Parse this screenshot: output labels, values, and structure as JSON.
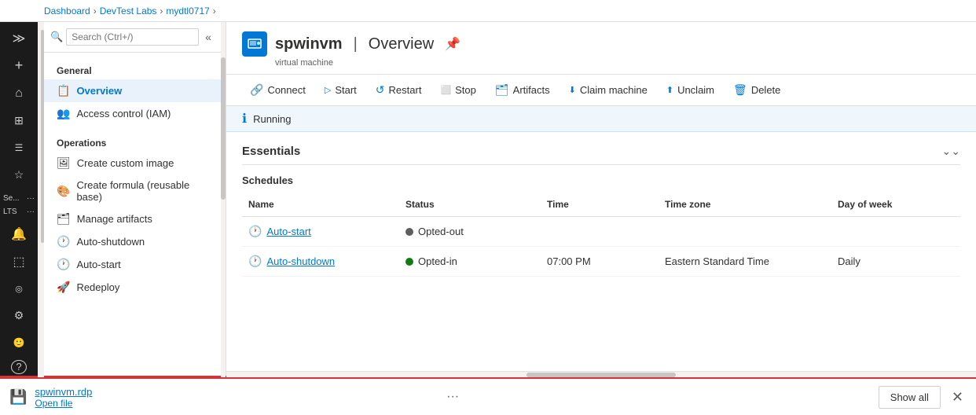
{
  "breadcrumb": {
    "items": [
      "Dashboard",
      "DevTest Labs",
      "mydtl0717"
    ],
    "separators": [
      ">",
      ">"
    ]
  },
  "sidebar_icons": [
    {
      "name": "expand-icon",
      "glyph": "≫"
    },
    {
      "name": "plus-icon",
      "glyph": "+"
    },
    {
      "name": "home-icon",
      "glyph": "⌂"
    },
    {
      "name": "grid-icon",
      "glyph": "⊞"
    },
    {
      "name": "menu-icon",
      "glyph": "☰"
    },
    {
      "name": "star-icon",
      "glyph": "☆"
    },
    {
      "name": "notification-icon",
      "glyph": "🔔"
    },
    {
      "name": "cloud-icon",
      "glyph": "☁"
    },
    {
      "name": "person-icon",
      "glyph": "👤"
    },
    {
      "name": "key-icon",
      "glyph": "🔑"
    },
    {
      "name": "settings-icon",
      "glyph": "⚙"
    },
    {
      "name": "chart-icon",
      "glyph": "📊"
    },
    {
      "name": "help-icon",
      "glyph": "?"
    }
  ],
  "side_tabs": [
    {
      "label": "Se...",
      "more": "···"
    },
    {
      "label": "LTS",
      "more": "···"
    }
  ],
  "nav": {
    "search_placeholder": "Search (Ctrl+/)",
    "sections": [
      {
        "label": "General",
        "items": [
          {
            "icon": "📋",
            "label": "Overview",
            "active": true
          },
          {
            "icon": "👥",
            "label": "Access control (IAM)",
            "active": false
          }
        ]
      },
      {
        "label": "Operations",
        "items": [
          {
            "icon": "🖼",
            "label": "Create custom image",
            "active": false
          },
          {
            "icon": "🎨",
            "label": "Create formula (reusable base)",
            "active": false
          },
          {
            "icon": "🗂",
            "label": "Manage artifacts",
            "active": false
          },
          {
            "icon": "🕐",
            "label": "Auto-shutdown",
            "active": false
          },
          {
            "icon": "🕐",
            "label": "Auto-start",
            "active": false
          },
          {
            "icon": "🚀",
            "label": "Redeploy",
            "active": false
          }
        ]
      }
    ]
  },
  "resource": {
    "name": "spwinvm",
    "separator": "|",
    "page": "Overview",
    "type_label": "virtual machine"
  },
  "toolbar": {
    "buttons": [
      {
        "label": "Connect",
        "icon": "🔗",
        "disabled": false
      },
      {
        "label": "Start",
        "icon": "▷",
        "disabled": false
      },
      {
        "label": "Restart",
        "icon": "↺",
        "disabled": false
      },
      {
        "label": "Stop",
        "icon": "⬜",
        "disabled": false
      },
      {
        "label": "Artifacts",
        "icon": "🗂",
        "disabled": false
      },
      {
        "label": "Claim machine",
        "icon": "⬇",
        "disabled": false
      },
      {
        "label": "Unclaim",
        "icon": "⬆",
        "disabled": false
      },
      {
        "label": "Delete",
        "icon": "🗑",
        "disabled": false
      }
    ]
  },
  "status": {
    "icon": "ℹ",
    "text": "Running"
  },
  "essentials": {
    "title": "Essentials"
  },
  "schedules": {
    "label": "Schedules",
    "columns": [
      "Name",
      "Status",
      "Time",
      "Time zone",
      "Day of week"
    ],
    "rows": [
      {
        "icon": "🕐",
        "name": "Auto-start",
        "status_dot": "grey",
        "status_text": "Opted-out",
        "time": "",
        "timezone": "",
        "day_of_week": ""
      },
      {
        "icon": "🕐",
        "name": "Auto-shutdown",
        "status_dot": "green",
        "status_text": "Opted-in",
        "time": "07:00 PM",
        "timezone": "Eastern Standard Time",
        "day_of_week": "Daily"
      }
    ]
  },
  "bottom_bar": {
    "filename": "spwinvm.rdp",
    "action_label": "Open file",
    "more_label": "···",
    "show_all_label": "Show all",
    "close_label": "✕"
  }
}
